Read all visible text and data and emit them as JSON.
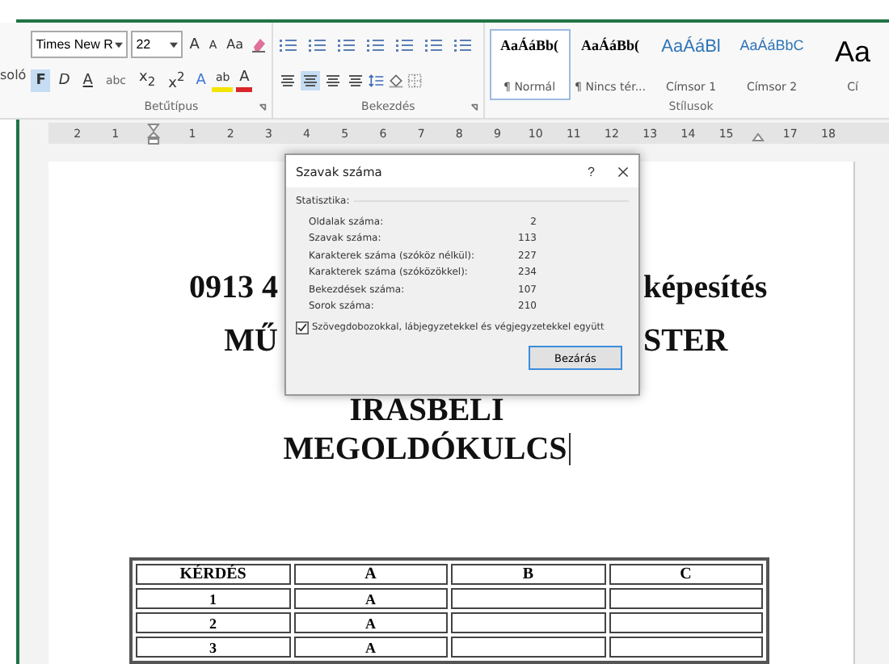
{
  "ribbon": {
    "cut_label": "soló",
    "font_group": {
      "label": "Betűtípus",
      "font_name": "Times New R",
      "font_size": "22",
      "size_tools": [
        {
          "kind": "grow",
          "text": "A"
        },
        {
          "kind": "shrink",
          "text": "A"
        },
        {
          "kind": "case",
          "text": "Aa"
        }
      ],
      "style_buttons": [
        {
          "kind": "bold",
          "text": "F",
          "selected": true
        },
        {
          "kind": "italic",
          "text": "D",
          "selected": false
        },
        {
          "kind": "underline",
          "text": "A",
          "selected": false
        },
        {
          "kind": "strike",
          "text": "abc",
          "selected": false
        },
        {
          "kind": "subscript",
          "text": "x$_{2}$",
          "selected": false
        },
        {
          "kind": "superscript",
          "text": "x$^{2}$",
          "selected": false
        }
      ],
      "color_tools": [
        {
          "kind": "effects",
          "text": "A"
        },
        {
          "kind": "highlight",
          "text": "ab"
        },
        {
          "kind": "font_color",
          "text": "A"
        }
      ]
    },
    "paragraph_group": {
      "label": "Bekezdés",
      "alignments": [
        {
          "selected": false
        },
        {
          "selected": true
        },
        {
          "selected": false
        },
        {
          "selected": false
        }
      ]
    },
    "styles_group": {
      "label": "Stílusok",
      "items": [
        {
          "kind": "body",
          "preview": "AaÁáBb(",
          "name": "¶ Normál",
          "selected": true
        },
        {
          "kind": "body",
          "preview": "AaÁáBb(",
          "name": "¶ Nincs tér...",
          "selected": false
        },
        {
          "kind": "heading1",
          "preview": "AaÁáBl",
          "name": "Címsor 1",
          "selected": false
        },
        {
          "kind": "heading2",
          "preview": "AaÁáBbC",
          "name": "Címsor 2",
          "selected": false
        },
        {
          "kind": "title",
          "preview": "Aa",
          "name": "Cí",
          "selected": false
        }
      ]
    }
  },
  "ruler": {
    "left_numbers": [
      "2",
      "1"
    ],
    "numbers": [
      "1",
      "2",
      "3",
      "4",
      "5",
      "6",
      "7",
      "8",
      "9",
      "10",
      "11",
      "12",
      "13",
      "14",
      "15"
    ],
    "right_numbers": [
      "17",
      "18"
    ]
  },
  "document": {
    "split_lines": [
      {
        "left": "0913 4",
        "right": "képesítés"
      },
      {
        "left": "MŰ",
        "right": "STER"
      }
    ],
    "lines": [
      "IRASBELI",
      "MEGOLDÓKULCS"
    ],
    "table": {
      "columns": [
        "KÉRDÉS",
        "A",
        "B",
        "C"
      ],
      "rows": [
        {
          "cells": [
            "1",
            "A"
          ]
        },
        {
          "cells": [
            "2",
            "A"
          ]
        },
        {
          "cells": [
            "3",
            "A"
          ]
        }
      ]
    }
  },
  "dialog": {
    "title": "Szavak száma",
    "help": "?",
    "section": "Statisztika:",
    "stats": [
      {
        "label": "Oldalak száma:",
        "value": "2"
      },
      {
        "label": "Szavak száma:",
        "value": "113"
      },
      {
        "label": "Karakterek száma (szóköz nélkül):",
        "value": "227"
      },
      {
        "label": "Karakterek száma (szóközökkel):",
        "value": "234"
      },
      {
        "label": "Bekezdések száma:",
        "value": "107"
      },
      {
        "label": "Sorok száma:",
        "value": "210"
      }
    ],
    "include_option": {
      "label": "Szövegdobozokkal, lábjegyzetekkel és végjegyzetekkel együtt",
      "checked": true
    },
    "close_button": "Bezárás"
  }
}
